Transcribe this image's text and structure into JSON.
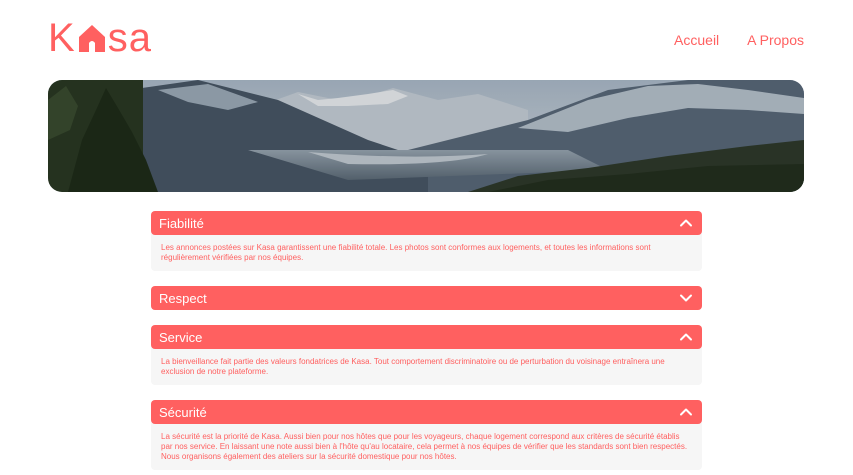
{
  "brand": {
    "logo_text": "Kasa",
    "color": "#FF6060"
  },
  "nav": {
    "items": [
      {
        "label": "Accueil"
      },
      {
        "label": "A Propos"
      }
    ]
  },
  "banner": {
    "image": "mountain-landscape"
  },
  "collapses": [
    {
      "title": "Fiabilité",
      "expanded": true,
      "icon": "chevron-up-icon",
      "text": "Les annonces postées sur Kasa garantissent une fiabilité totale. Les photos sont conformes aux logements, et toutes les informations sont régulièrement vérifiées par nos équipes."
    },
    {
      "title": "Respect",
      "expanded": false,
      "icon": "chevron-down-icon",
      "text": ""
    },
    {
      "title": "Service",
      "expanded": true,
      "icon": "chevron-up-icon",
      "text": "La bienveillance fait partie des valeurs fondatrices de Kasa. Tout comportement discriminatoire ou de perturbation du voisinage entraînera une exclusion de notre plateforme."
    },
    {
      "title": "Sécurité",
      "expanded": true,
      "icon": "chevron-up-icon",
      "text": "La sécurité est la priorité de Kasa. Aussi bien pour nos hôtes que pour les voyageurs, chaque logement correspond aux critères de sécurité établis par nos service. En laissant une note aussi bien à l'hôte qu'au locataire, cela permet à nos équipes de vérifier que les standards sont bien respectés. Nous organisons également des ateliers sur la sécurité domestique pour nos hôtes."
    }
  ]
}
